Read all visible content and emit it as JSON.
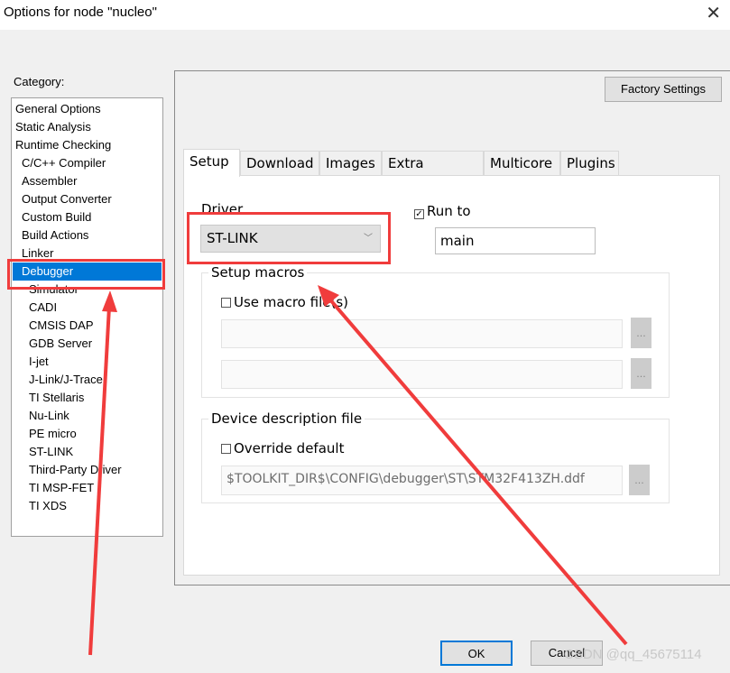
{
  "window": {
    "title": "Options for node \"nucleo\"",
    "close": "✕"
  },
  "category": {
    "label": "Category:",
    "items": [
      {
        "label": "General Options",
        "level": 0
      },
      {
        "label": "Static Analysis",
        "level": 0
      },
      {
        "label": "Runtime Checking",
        "level": 0
      },
      {
        "label": "C/C++ Compiler",
        "level": 1
      },
      {
        "label": "Assembler",
        "level": 1
      },
      {
        "label": "Output Converter",
        "level": 1
      },
      {
        "label": "Custom Build",
        "level": 1
      },
      {
        "label": "Build Actions",
        "level": 1
      },
      {
        "label": "Linker",
        "level": 1
      },
      {
        "label": "Debugger",
        "level": 1,
        "selected": true
      },
      {
        "label": "Simulator",
        "level": 2
      },
      {
        "label": "CADI",
        "level": 2
      },
      {
        "label": "CMSIS DAP",
        "level": 2
      },
      {
        "label": "GDB Server",
        "level": 2
      },
      {
        "label": "I-jet",
        "level": 2
      },
      {
        "label": "J-Link/J-Trace",
        "level": 2
      },
      {
        "label": "TI Stellaris",
        "level": 2
      },
      {
        "label": "Nu-Link",
        "level": 2
      },
      {
        "label": "PE micro",
        "level": 2
      },
      {
        "label": "ST-LINK",
        "level": 2
      },
      {
        "label": "Third-Party Driver",
        "level": 2
      },
      {
        "label": "TI MSP-FET",
        "level": 2
      },
      {
        "label": "TI XDS",
        "level": 2
      }
    ]
  },
  "factory_settings": "Factory Settings",
  "tabs": [
    "Setup",
    "Download",
    "Images",
    "Extra Options",
    "Multicore",
    "Plugins"
  ],
  "setup": {
    "driver_label": "Driver",
    "driver_value": "ST-LINK",
    "run_to_label": "Run to",
    "run_to_checked": true,
    "run_to_value": "main",
    "macros_label": "Setup macros",
    "use_macro_label": "Use macro file(s)",
    "use_macro_checked": false,
    "macro_file_1": "",
    "macro_file_2": "",
    "browse": "...",
    "ddf_label": "Device description file",
    "override_label": "Override default",
    "override_checked": false,
    "ddf_value": "$TOOLKIT_DIR$\\CONFIG\\debugger\\ST\\STM32F413ZH.ddf"
  },
  "ok": "OK",
  "cancel": "Cancel",
  "watermark": "CSDN @qq_45675114",
  "colors": {
    "selection": "#0078d7",
    "annotation": "#f03c3c"
  }
}
